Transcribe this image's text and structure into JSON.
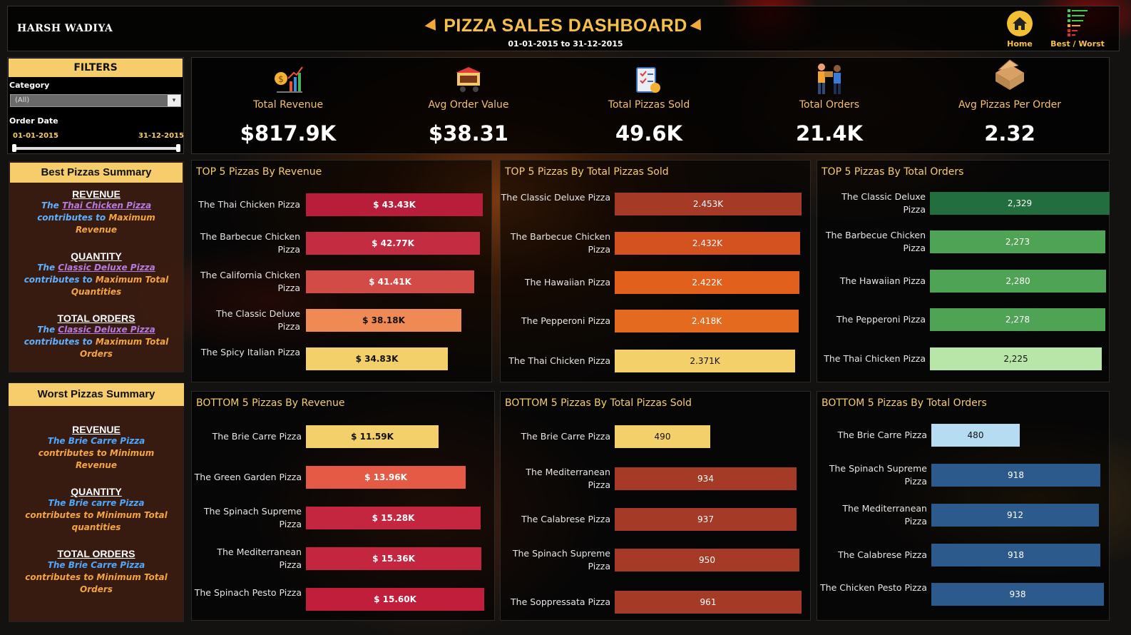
{
  "header": {
    "brand": "HARSH WADIYA",
    "title": "PIZZA SALES DASHBOARD",
    "date_range": "01-01-2015 to 31-12-2015",
    "home_label": "Home",
    "best_worst_label": "Best / Worst"
  },
  "filters": {
    "title": "FILTERS",
    "category_label": "Category",
    "category_value": "(All)",
    "order_date_label": "Order Date",
    "date_start": "01-01-2015",
    "date_end": "31-12-2015"
  },
  "best_summary": {
    "title": "Best Pizzas Summary",
    "sections": [
      {
        "heading": "REVENUE",
        "pre": "The ",
        "pizza": "Thai Chicken Pizza",
        "mid": " contributes to ",
        "tail": "Maximum Revenue"
      },
      {
        "heading": "QUANTITY",
        "pre": "The ",
        "pizza": "Classic Deluxe Pizza",
        "mid": " contributes to ",
        "tail": "Maximum Total Quantities"
      },
      {
        "heading": "TOTAL ORDERS",
        "pre": "The ",
        "pizza": "Classic Deluxe Pizza",
        "mid": " contributes to ",
        "tail": "Maximum Total Orders"
      }
    ]
  },
  "worst_summary": {
    "title": "Worst Pizzas Summary",
    "sections": [
      {
        "heading": "REVENUE",
        "line1": "The Brie Carre Pizza",
        "line2": "contributes to Minimum",
        "line3": "Revenue"
      },
      {
        "heading": "QUANTITY",
        "line1": "The Brie carre Pizza",
        "line2": "contributes to Minimum Total",
        "line3": "quantities"
      },
      {
        "heading": "TOTAL ORDERS",
        "line1": "The Brie Carre Pizza",
        "line2": "contributes to Minimum Total",
        "line3": "Orders"
      }
    ]
  },
  "kpis": [
    {
      "label": "Total Revenue",
      "value": "$817.9K",
      "icon": "revenue-chart-icon"
    },
    {
      "label": "Avg Order Value",
      "value": "$38.31",
      "icon": "pizza-cart-icon"
    },
    {
      "label": "Total Pizzas Sold",
      "value": "49.6K",
      "icon": "checklist-icon"
    },
    {
      "label": "Total Orders",
      "value": "21.4K",
      "icon": "delivery-people-icon"
    },
    {
      "label": "Avg Pizzas Per Order",
      "value": "2.32",
      "icon": "pizza-box-icon"
    }
  ],
  "chart_data": [
    {
      "type": "bar",
      "orientation": "horizontal",
      "title": "TOP 5 Pizzas By Revenue",
      "categories": [
        "The Thai Chicken Pizza",
        "The Barbecue Chicken Pizza",
        "The California Chicken Pizza",
        "The Classic Deluxe Pizza",
        "The Spicy Italian Pizza"
      ],
      "values": [
        43.43,
        42.77,
        41.41,
        38.18,
        34.83
      ],
      "labels": [
        "$ 43.43K",
        "$ 42.77K",
        "$ 41.41K",
        "$ 38.18K",
        "$ 34.83K"
      ],
      "colors": [
        "#b81e3a",
        "#c42c42",
        "#d34b47",
        "#f08a55",
        "#f3d06a"
      ],
      "label_colors": [
        "#ffffff",
        "#ffffff",
        "#ffffff",
        "#111111",
        "#111111"
      ],
      "max": 43.43
    },
    {
      "type": "bar",
      "orientation": "horizontal",
      "title": "TOP 5 Pizzas By Total Pizzas Sold",
      "categories": [
        "The Classic Deluxe Pizza",
        "The Barbecue Chicken Pizza",
        "The Hawaiian Pizza",
        "The Pepperoni Pizza",
        "The Thai Chicken Pizza"
      ],
      "values": [
        2453,
        2432,
        2422,
        2418,
        2371
      ],
      "labels": [
        "2.453K",
        "2.432K",
        "2.422K",
        "2.418K",
        "2.371K"
      ],
      "colors": [
        "#a53a26",
        "#d4521f",
        "#e0601c",
        "#e36a1f",
        "#f3d06a"
      ],
      "label_colors": [
        "#ffffff",
        "#ffffff",
        "#ffffff",
        "#ffffff",
        "#111111"
      ],
      "max": 2453
    },
    {
      "type": "bar",
      "orientation": "horizontal",
      "title": "TOP 5 Pizzas By Total Orders",
      "categories": [
        "The Classic Deluxe Pizza",
        "The Barbecue Chicken Pizza",
        "The Hawaiian Pizza",
        "The Pepperoni Pizza",
        "The Thai Chicken Pizza"
      ],
      "values": [
        2329,
        2273,
        2280,
        2278,
        2225
      ],
      "labels": [
        "2,329",
        "2,273",
        "2,280",
        "2,278",
        "2,225"
      ],
      "colors": [
        "#226e3e",
        "#4ea354",
        "#4ea354",
        "#4ea354",
        "#b8e6a8"
      ],
      "label_colors": [
        "#ffffff",
        "#ffffff",
        "#ffffff",
        "#ffffff",
        "#111111"
      ],
      "max": 2329
    },
    {
      "type": "bar",
      "orientation": "horizontal",
      "title": "BOTTOM 5 Pizzas By Revenue",
      "categories": [
        "The Brie Carre Pizza",
        "The Green Garden Pizza",
        "The Spinach Supreme Pizza",
        "The Mediterranean Pizza",
        "The Spinach Pesto Pizza"
      ],
      "values": [
        11.59,
        13.96,
        15.28,
        15.36,
        15.6
      ],
      "labels": [
        "$ 11.59K",
        "$ 13.96K",
        "$ 15.28K",
        "$ 15.36K",
        "$ 15.60K"
      ],
      "colors": [
        "#f3d06a",
        "#e45a44",
        "#c4263f",
        "#c4263f",
        "#c01e3a"
      ],
      "label_colors": [
        "#111111",
        "#ffffff",
        "#ffffff",
        "#ffffff",
        "#ffffff"
      ],
      "max": 15.6
    },
    {
      "type": "bar",
      "orientation": "horizontal",
      "title": "BOTTOM 5 Pizzas By Total Pizzas Sold",
      "categories": [
        "The Brie Carre Pizza",
        "The Mediterranean Pizza",
        "The Calabrese Pizza",
        "The Spinach Supreme Pizza",
        "The Soppressata Pizza"
      ],
      "values": [
        490,
        934,
        937,
        950,
        961
      ],
      "labels": [
        "490",
        "934",
        "937",
        "950",
        "961"
      ],
      "colors": [
        "#f3d06a",
        "#a53a26",
        "#a53a26",
        "#a53a26",
        "#a53a26"
      ],
      "label_colors": [
        "#111111",
        "#ffffff",
        "#ffffff",
        "#ffffff",
        "#ffffff"
      ],
      "max": 961
    },
    {
      "type": "bar",
      "orientation": "horizontal",
      "title": "BOTTOM 5 Pizzas By Total Orders",
      "categories": [
        "The Brie Carre Pizza",
        "The Spinach Supreme Pizza",
        "The Mediterranean Pizza",
        "The Calabrese Pizza",
        "The Chicken Pesto Pizza"
      ],
      "values": [
        480,
        918,
        912,
        918,
        938
      ],
      "labels": [
        "480",
        "918",
        "912",
        "918",
        "938"
      ],
      "colors": [
        "#b6dcf2",
        "#2d5a8c",
        "#2d5a8c",
        "#2d5a8c",
        "#2d5a8c"
      ],
      "label_colors": [
        "#111111",
        "#ffffff",
        "#ffffff",
        "#ffffff",
        "#ffffff"
      ],
      "max": 938
    }
  ]
}
